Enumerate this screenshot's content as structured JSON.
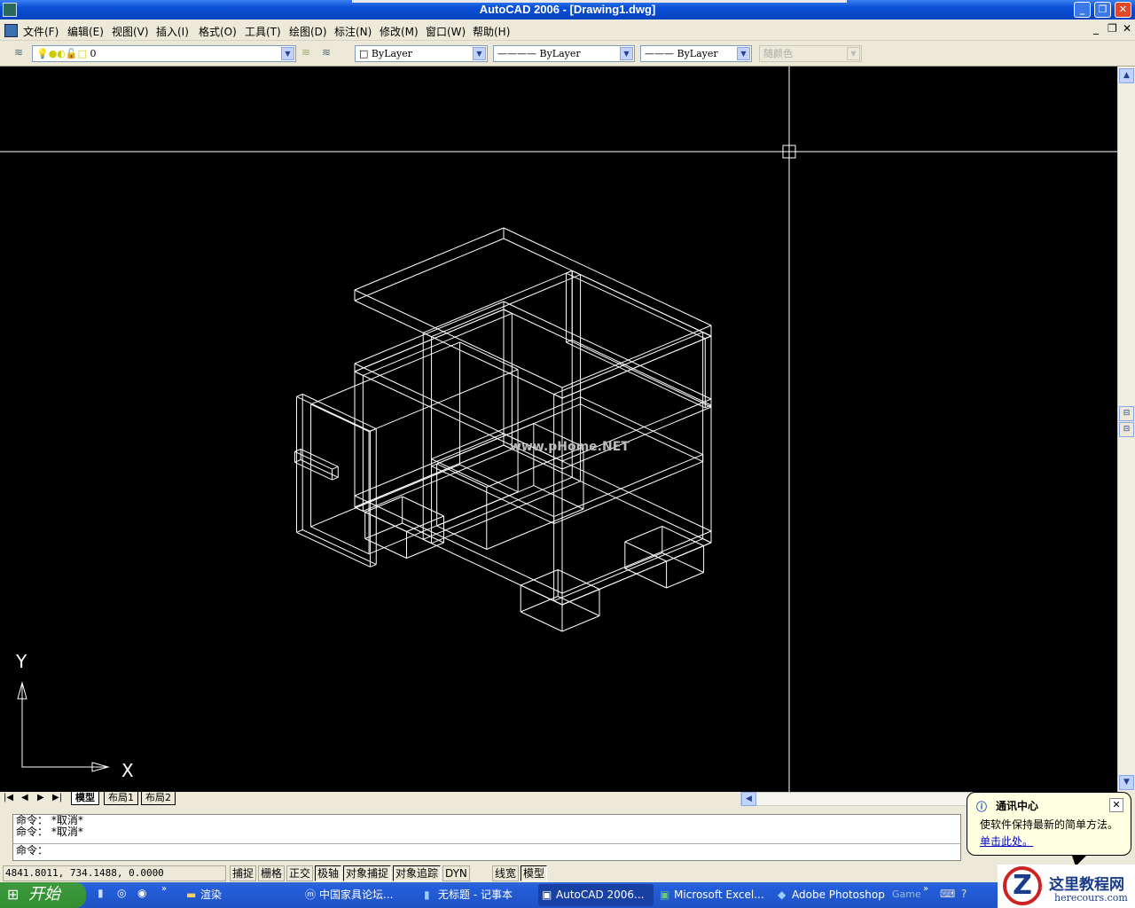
{
  "window": {
    "title": "AutoCAD 2006 - [Drawing1.dwg]"
  },
  "menu": [
    "文件(F)",
    "编辑(E)",
    "视图(V)",
    "插入(I)",
    "格式(O)",
    "工具(T)",
    "绘图(D)",
    "标注(N)",
    "修改(M)",
    "窗口(W)",
    "帮助(H)"
  ],
  "toolbar": {
    "layer": "0",
    "color": "ByLayer",
    "linetype": "ByLayer",
    "lineweight": "ByLayer",
    "plotstyle": "随颜色"
  },
  "drawing": {
    "watermark": "www.pHome.NET",
    "ucs_x": "X",
    "ucs_y": "Y"
  },
  "tabs": [
    "模型",
    "布局1",
    "布局2"
  ],
  "command": {
    "history": [
      "命令： *取消*",
      "命令： *取消*"
    ],
    "prompt": "命令："
  },
  "status": {
    "coords": "4841.8011, 734.1488, 0.0000",
    "buttons": [
      {
        "label": "捕捉",
        "on": false
      },
      {
        "label": "栅格",
        "on": false
      },
      {
        "label": "正交",
        "on": false
      },
      {
        "label": "极轴",
        "on": true
      },
      {
        "label": "对象捕捉",
        "on": true
      },
      {
        "label": "对象追踪",
        "on": true
      },
      {
        "label": "DYN",
        "on": false
      },
      {
        "label": "线宽",
        "on": false
      },
      {
        "label": "模型",
        "on": true
      }
    ]
  },
  "balloon": {
    "title": "通讯中心",
    "text": "使软件保持最新的简单方法。",
    "link": "单击此处。"
  },
  "taskbar": {
    "start": "开始",
    "items": [
      "渲染",
      "中国家具论坛...",
      "无标题 - 记事本",
      "AutoCAD 2006...",
      "Microsoft Excel...",
      "Adobe Photoshop"
    ],
    "extra": "Game"
  },
  "logo": {
    "name": "这里教程网",
    "url": "herecours.com"
  },
  "colors": {
    "titlebar": "#0a4fd6",
    "canvas": "#000000",
    "wireframe": "#ffffff",
    "taskbar": "#245edb",
    "start": "#329032"
  }
}
